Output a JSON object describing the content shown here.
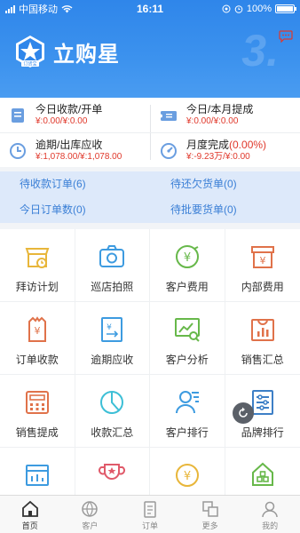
{
  "status_bar": {
    "carrier": "中国移动",
    "time": "16:11",
    "battery": "100%"
  },
  "header": {
    "app_title": "立购星",
    "logo_badge": "订货宝",
    "deco_text": "3."
  },
  "stats": [
    {
      "title": "今日收款/开单",
      "value": "¥:0.00/¥:0.00"
    },
    {
      "title": "今日/本月提成",
      "value": "¥:0.00/¥:0.00"
    },
    {
      "title": "逾期/出库应收",
      "value": "¥:1,078.00/¥:1,078.00"
    },
    {
      "title_prefix": "月度完成",
      "title_pct": "(0.00%)",
      "value": "¥:-9.23万/¥:0.00"
    }
  ],
  "orders": [
    {
      "label": "待收款订单",
      "count": "(6)"
    },
    {
      "label": "待还欠货单",
      "count": "(0)"
    },
    {
      "label": "今日订单数",
      "count": "(0)"
    },
    {
      "label": "待批要货单",
      "count": "(0)"
    }
  ],
  "grid": [
    {
      "label": "拜访计划",
      "icon": "visit-plan-icon"
    },
    {
      "label": "巡店拍照",
      "icon": "camera-icon"
    },
    {
      "label": "客户费用",
      "icon": "customer-fee-icon"
    },
    {
      "label": "内部费用",
      "icon": "internal-fee-icon"
    },
    {
      "label": "订单收款",
      "icon": "order-payment-icon"
    },
    {
      "label": "逾期应收",
      "icon": "overdue-receivable-icon"
    },
    {
      "label": "客户分析",
      "icon": "customer-analysis-icon"
    },
    {
      "label": "销售汇总",
      "icon": "sales-summary-icon"
    },
    {
      "label": "销售提成",
      "icon": "sales-commission-icon"
    },
    {
      "label": "收款汇总",
      "icon": "payment-summary-icon"
    },
    {
      "label": "客户排行",
      "icon": "customer-ranking-icon"
    },
    {
      "label": "品牌排行",
      "icon": "brand-ranking-icon"
    }
  ],
  "tabs": [
    {
      "label": "首页",
      "icon": "home-icon"
    },
    {
      "label": "客户",
      "icon": "customer-icon"
    },
    {
      "label": "订单",
      "icon": "order-icon"
    },
    {
      "label": "更多",
      "icon": "more-icon"
    },
    {
      "label": "我的",
      "icon": "profile-icon"
    }
  ],
  "colors": {
    "primary": "#2f86ea",
    "accent_red": "#e0382b",
    "order_text": "#3a7fd6"
  }
}
